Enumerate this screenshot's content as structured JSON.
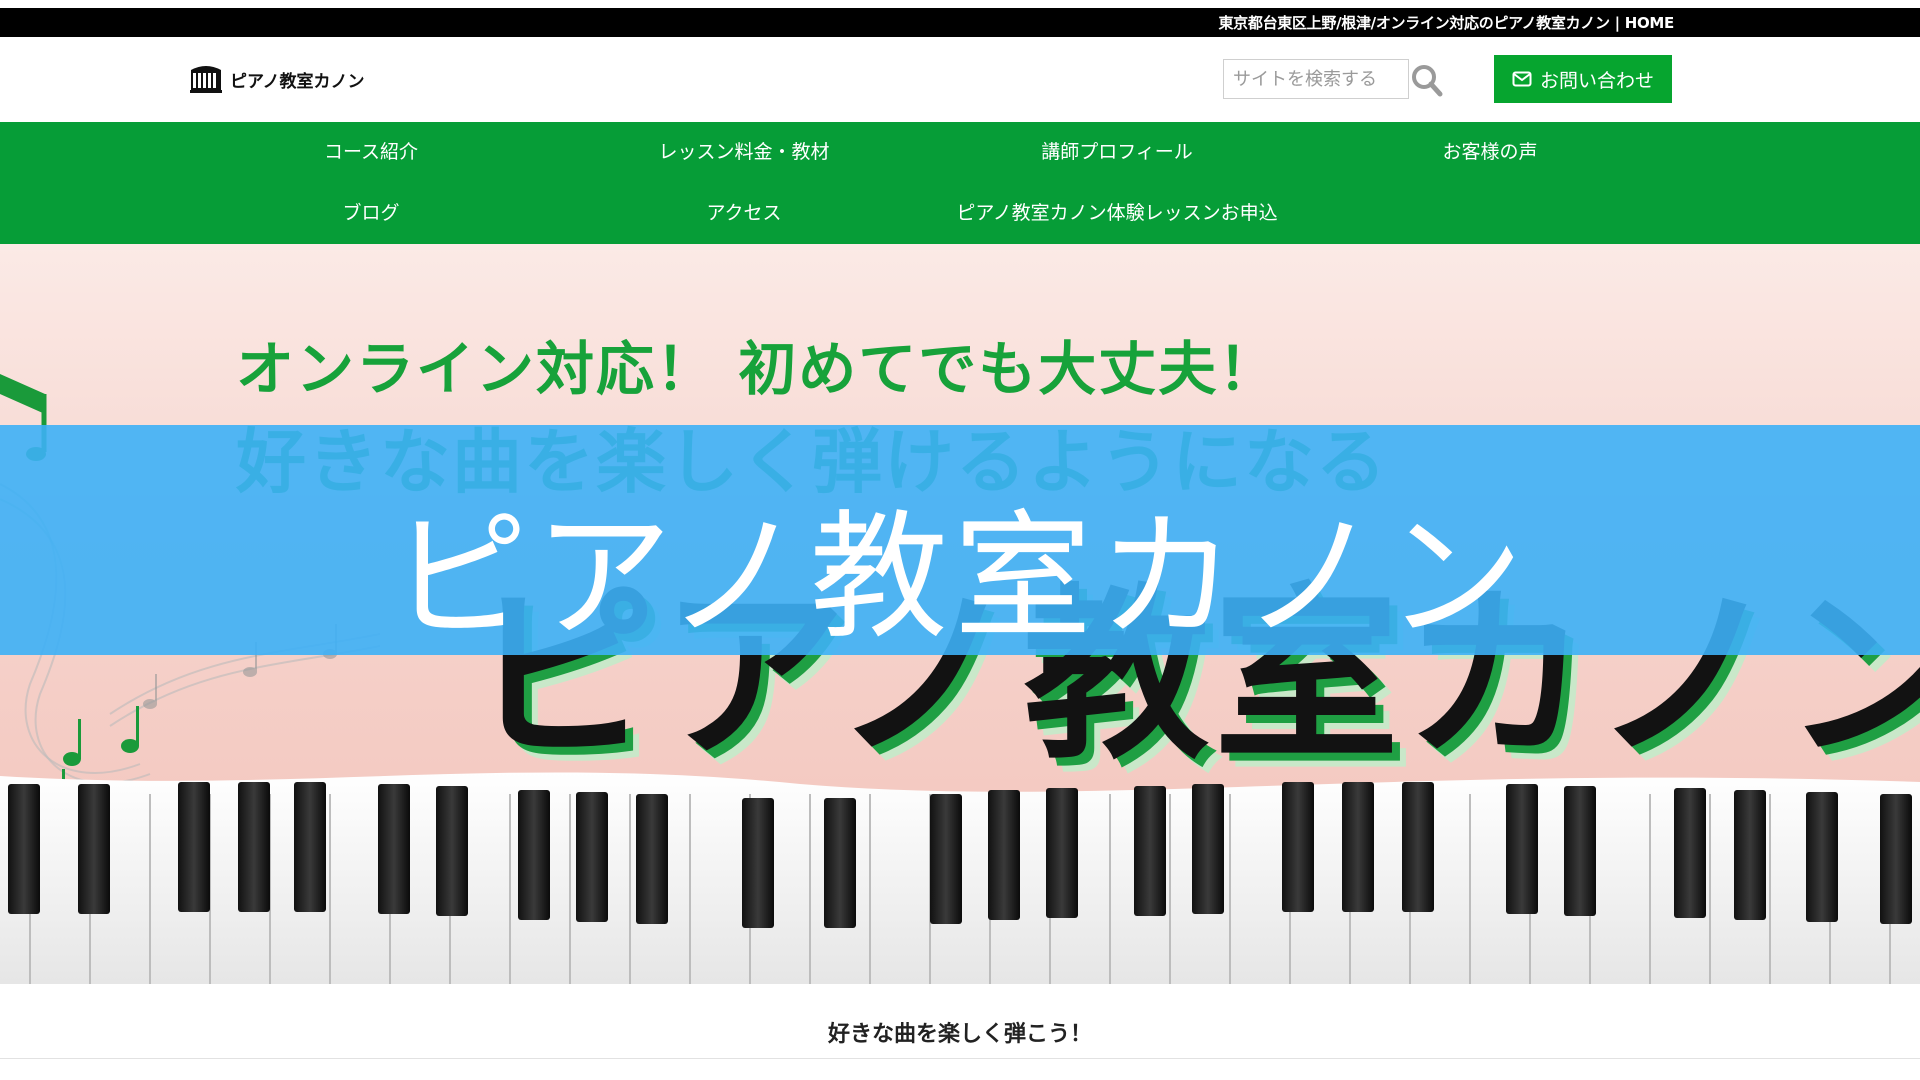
{
  "topbar": {
    "text": "東京都台東区上野/根津/オンライン対応のピアノ教室カノン | HOME"
  },
  "header": {
    "logo_text": "ピアノ教室カノン",
    "search_placeholder": "サイトを検索する",
    "contact_label": "お問い合わせ"
  },
  "nav": {
    "items": [
      {
        "label": "コース紹介"
      },
      {
        "label": "レッスン料金・教材"
      },
      {
        "label": "講師プロフィール"
      },
      {
        "label": "お客様の声"
      },
      {
        "label": "ブログ"
      },
      {
        "label": "アクセス"
      },
      {
        "label": "ピアノ教室カノン体験レッスンお申込"
      }
    ]
  },
  "hero": {
    "headline": "オンライン対応！ 初めてでも大丈夫！",
    "subheadline": "好きな曲を楽しく弾けるようになる",
    "big_name": "ピアノ教室カノン"
  },
  "banner": {
    "title": "ピアノ教室カノン"
  },
  "tagline": "好きな曲を楽しく弾こう！",
  "colors": {
    "nav_green": "#069d37",
    "contact_green": "#06a52f",
    "banner_blue": "#3db0f6",
    "hero_pink": "#f6d3cc"
  }
}
